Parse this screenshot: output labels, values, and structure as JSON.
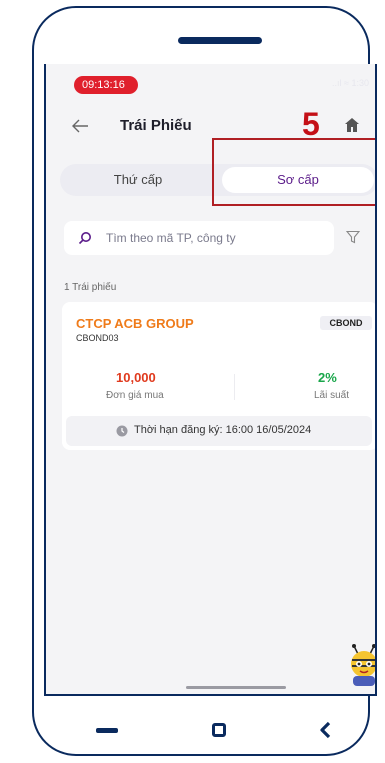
{
  "status_bar": {
    "time": "09:13:16",
    "right": "..ıl ≈ 1:30"
  },
  "header": {
    "title": "Trái Phiếu"
  },
  "annotation": {
    "step": "5"
  },
  "tabs": [
    {
      "label": "Thứ cấp"
    },
    {
      "label": "Sơ cấp"
    }
  ],
  "search": {
    "placeholder": "Tìm theo mã TP, công ty"
  },
  "list": {
    "count_label": "1 Trái phiếu"
  },
  "bond": {
    "name": "CTCP ACB GROUP",
    "code": "CBOND03",
    "badge": "CBOND",
    "price_value": "10,000",
    "price_label": "Đơn giá mua",
    "rate_value": "2%",
    "rate_label": "Lãi suất",
    "deadline": "Thời hạn đăng ký: 16:00 16/05/2024"
  },
  "colors": {
    "accent": "#5b1c8a",
    "brand_orange": "#ef7b1a",
    "price": "#e03a1e",
    "rate": "#19a64a",
    "frame": "#0a2a5e",
    "annotation": "#c41017"
  },
  "icons": [
    "back-arrow-icon",
    "home-icon",
    "search-icon",
    "filter-icon",
    "clock-icon",
    "assistant-bee-icon"
  ]
}
